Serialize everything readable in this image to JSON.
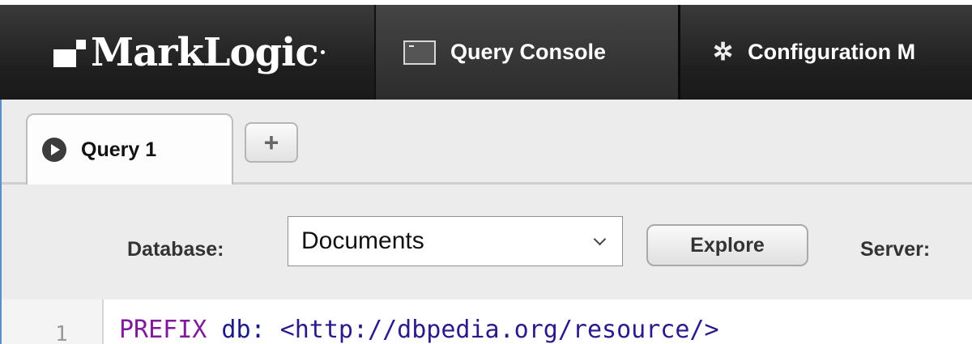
{
  "app": {
    "logo_text": "MarkLogic"
  },
  "nav": {
    "tabs": [
      {
        "label": "Query Console",
        "icon": "console-icon",
        "active": true
      },
      {
        "label": "Configuration M",
        "icon": "gear-icon",
        "active": false
      }
    ]
  },
  "query_tabs": {
    "tabs": [
      {
        "label": "Query 1",
        "icon": "play-circle-icon"
      }
    ],
    "add_label": "+"
  },
  "toolbar": {
    "database_label": "Database:",
    "database_value": "Documents",
    "explore_label": "Explore",
    "server_label": "Server:"
  },
  "editor": {
    "line_number": "1",
    "code": {
      "keyword": "PREFIX",
      "prefix": " db: ",
      "iri": "<http://dbpedia.org/resource/>"
    }
  },
  "colors": {
    "topbar": "#1e1e1e",
    "accent_border": "#5b8fc9",
    "keyword": "#7f1b9b"
  }
}
